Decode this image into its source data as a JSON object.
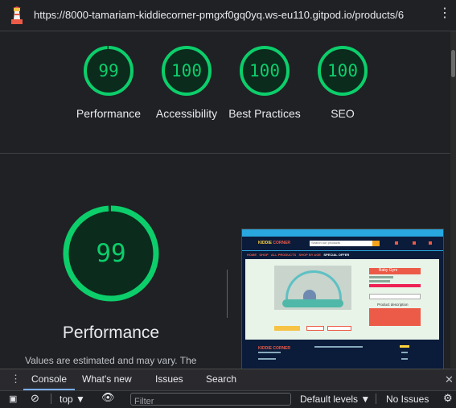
{
  "titlebar": {
    "url": "https://8000-tamariam-kiddiecorner-pmgxf0gq0yq.ws-eu110.gitpod.io/products/6",
    "menu_icon": "⋮"
  },
  "scores": [
    {
      "label": "Performance",
      "score": "99",
      "fraction": 0.99
    },
    {
      "label": "Accessibility",
      "score": "100",
      "fraction": 1.0
    },
    {
      "label": "Best Practices",
      "score": "100",
      "fraction": 1.0
    },
    {
      "label": "SEO",
      "score": "100",
      "fraction": 1.0
    }
  ],
  "main": {
    "score": "99",
    "fraction": 0.99,
    "label": "Performance",
    "note": "Values are estimated and may vary. The"
  },
  "thumbnail": {
    "logo_left": "KIDDIE",
    "logo_right": "CORNER",
    "search_placeholder": "Search our products",
    "nav": [
      "HOME",
      "SHOP",
      "ALL PRODUCTS",
      "SHOP BY AGE",
      "SPECIAL OFFER"
    ],
    "product_title": "Baby Gym",
    "product_description": "Product description",
    "footer_brand": "KIDDIE CORNER"
  },
  "devtools": {
    "tabs": [
      "Console",
      "What's new",
      "Issues",
      "Search"
    ],
    "active_tab": "Console",
    "context": "top",
    "filter_placeholder": "Filter",
    "levels": "Default levels",
    "issues": "No Issues"
  },
  "colors": {
    "accent": "#0cce6b",
    "gauge_fill": "#0b2b1c",
    "background": "#202124",
    "tab_underline": "#7cacf8"
  }
}
